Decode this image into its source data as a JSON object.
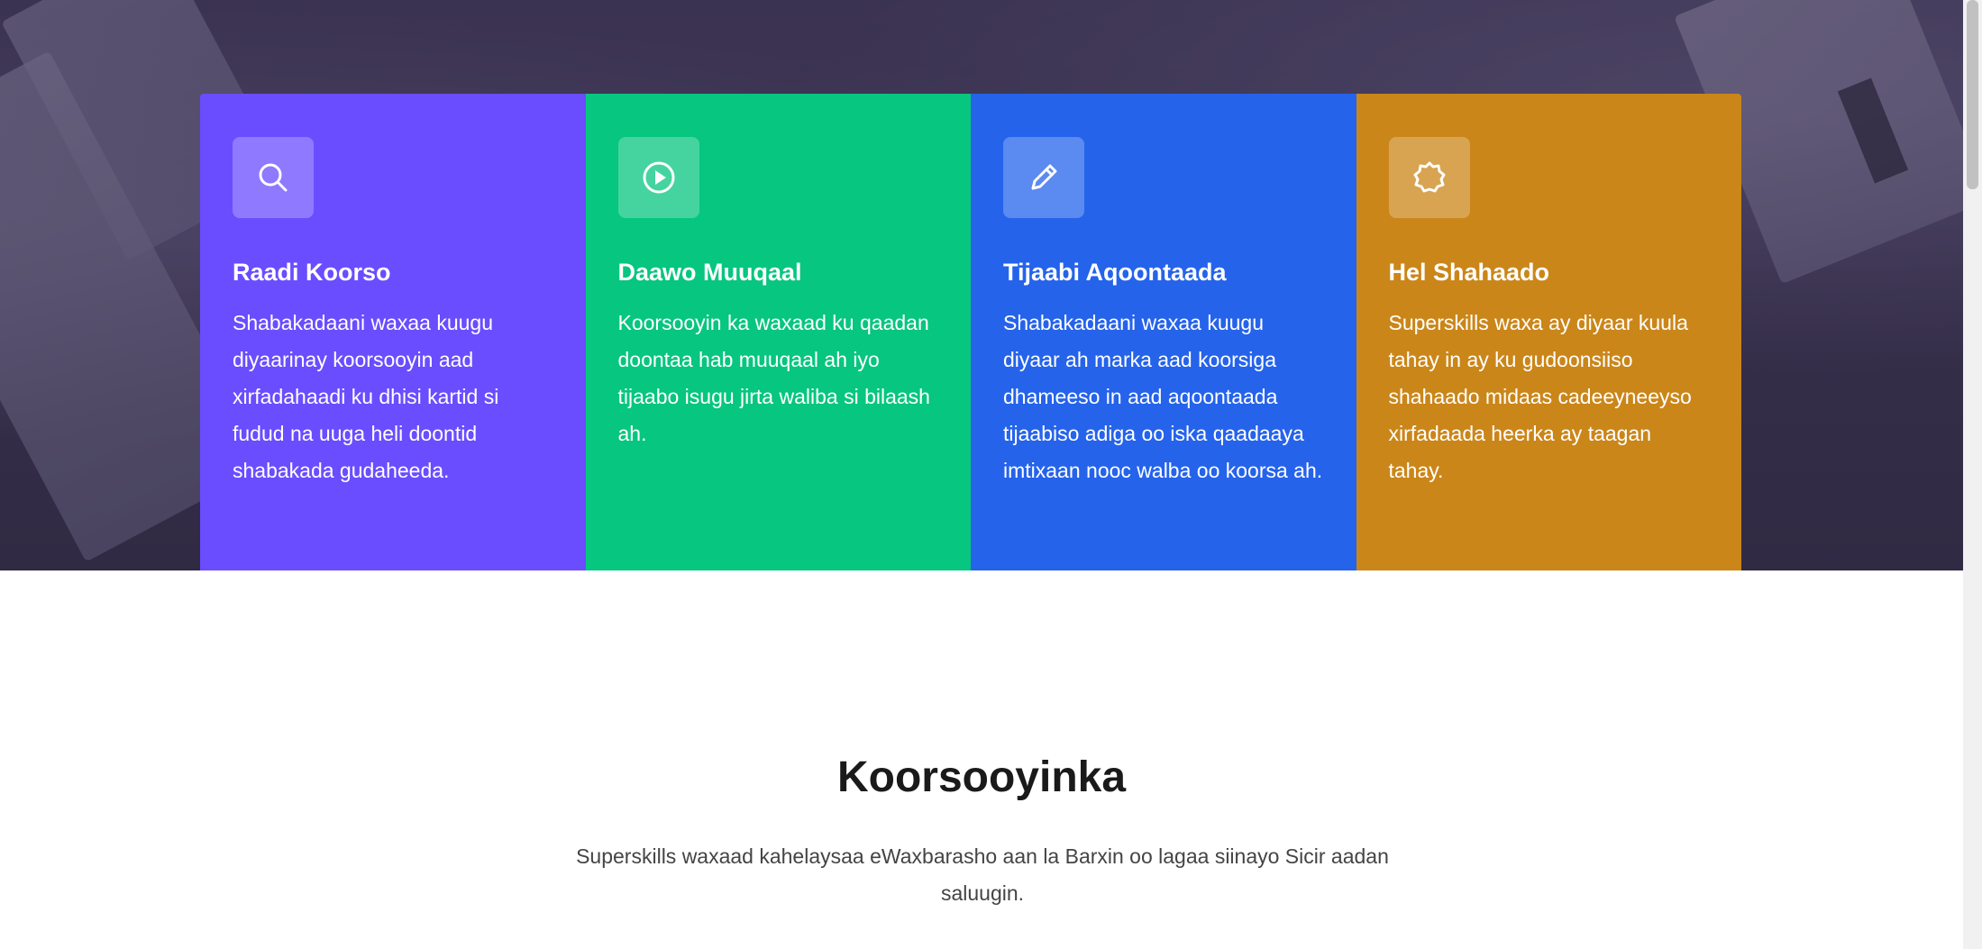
{
  "colors": {
    "card1": "#6a4dff",
    "card2": "#07c67f",
    "card3": "#2563eb",
    "card4": "#cb8619"
  },
  "features": [
    {
      "icon": "search-icon",
      "title": "Raadi Koorso",
      "text": "Shabakadaani waxaa kuugu diyaarinay koorsooyin aad xirfadahaadi ku dhisi kartid si fudud na uuga heli doontid shabakada gudaheeda."
    },
    {
      "icon": "play-icon",
      "title": "Daawo Muuqaal",
      "text": "Koorsooyin ka waxaad ku qaadan doontaa hab muuqaal ah iyo tijaabo isugu jirta waliba si bilaash ah."
    },
    {
      "icon": "pencil-icon",
      "title": "Tijaabi Aqoontaada",
      "text": "Shabakadaani waxaa kuugu diyaar ah marka aad koorsiga dhameeso in aad aqoontaada tijaabiso adiga oo iska qaadaaya imtixaan nooc walba oo koorsa ah."
    },
    {
      "icon": "badge-icon",
      "title": "Hel Shahaado",
      "text": "Superskills waxa ay diyaar kuula tahay in ay ku gudoonsiiso shahaado midaas cadeeyneeyso xirfadaada heerka ay taagan tahay."
    }
  ],
  "courses": {
    "title": "Koorsooyinka",
    "subtitle": "Superskills waxaad kahelaysaa eWaxbarasho aan la Barxin oo lagaa siinayo Sicir aadan saluugin."
  }
}
